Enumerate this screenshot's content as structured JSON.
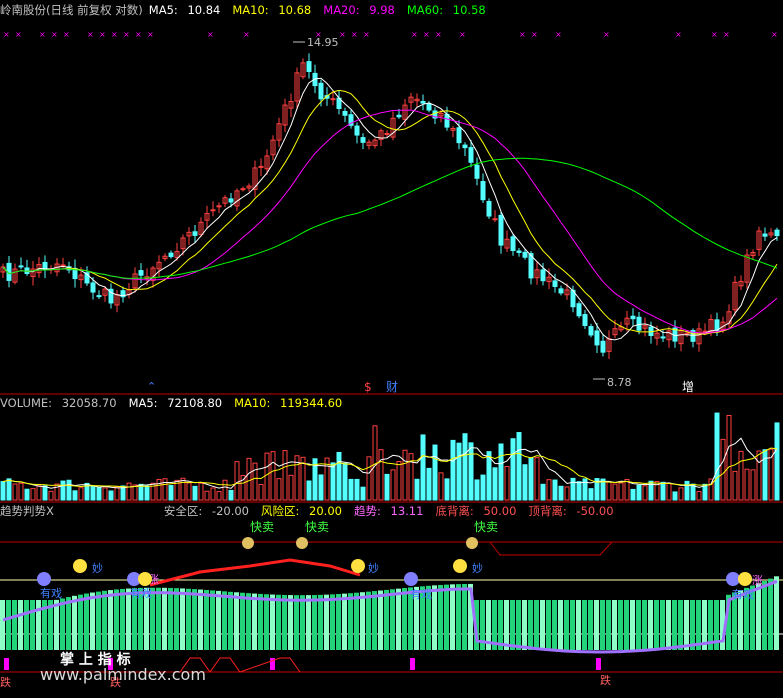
{
  "colors": {
    "background": "#000000",
    "up": "#ff4040",
    "down": "#54ffff",
    "ma5": "#ffffff",
    "ma10": "#ffff00",
    "ma20": "#ff00ff",
    "ma60": "#00ff00",
    "divider": "#c00000",
    "vol_ma5": "#ffffff",
    "vol_ma10": "#ffff00",
    "ind_title": "#c0c0c0",
    "safe": "#c0c0c0",
    "risk": "#ffff00",
    "trend": "#ff66ff",
    "bottom": "#ff5050",
    "top": "#ff5050"
  },
  "price_panel": {
    "title": "岭南股份(日线 前复权 对数)",
    "ma5": {
      "label": "MA5:",
      "value": "10.84"
    },
    "ma10": {
      "label": "MA10:",
      "value": "10.68"
    },
    "ma20": {
      "label": "MA20:",
      "value": "9.98"
    },
    "ma60": {
      "label": "MA60:",
      "value": "10.58"
    },
    "high_label": "14.95",
    "low_label": "8.78",
    "markers": [
      "$",
      "财",
      "增"
    ]
  },
  "volume_panel": {
    "title": "VOLUME:",
    "value": "32058.70",
    "ma5": {
      "label": "MA5:",
      "value": "72108.80"
    },
    "ma10": {
      "label": "MA10:",
      "value": "119344.60"
    }
  },
  "indicator_panel": {
    "title": "趋势判势X",
    "safe": {
      "label": "安全区:",
      "value": "-20.00"
    },
    "risk": {
      "label": "风险区:",
      "value": "20.00"
    },
    "trend": {
      "label": "趋势:",
      "value": "13.11"
    },
    "bottom": {
      "label": "底背离:",
      "value": "50.00"
    },
    "top": {
      "label": "顶背离:",
      "value": "-50.00"
    },
    "sell_label": "快卖",
    "signals": [
      "有戏",
      "涨",
      "妙",
      "跌"
    ],
    "logo_text": "掌 上 指 标",
    "watermark": "www.palmindex.com"
  },
  "chart_data": {
    "type": "candlestick",
    "title": "岭南股份(日线 前复权 对数)",
    "y_scale": "log",
    "high": 14.95,
    "low": 8.78,
    "moving_averages": {
      "MA5": 10.84,
      "MA10": 10.68,
      "MA20": 9.98,
      "MA60": 10.58
    },
    "volume": {
      "VOLUME": 32058.7,
      "MA5": 72108.8,
      "MA10": 119344.6
    },
    "indicator": {
      "安全区": -20.0,
      "风险区": 20.0,
      "趋势": 13.11,
      "底背离": 50.0,
      "顶背离": -50.0
    }
  }
}
